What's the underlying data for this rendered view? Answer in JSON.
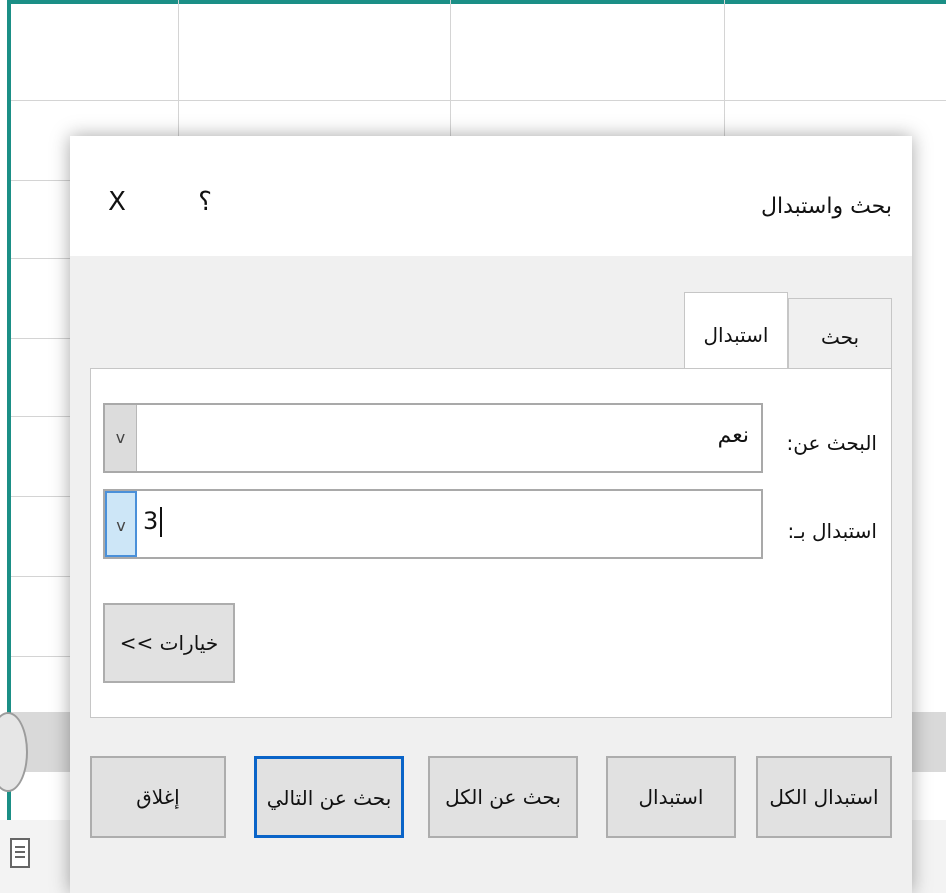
{
  "dialog": {
    "title": "بحث واستبدال",
    "help_label": "؟",
    "close_label": "X"
  },
  "tabs": [
    {
      "label": "بحث",
      "active": false
    },
    {
      "label": "استبدال",
      "active": true
    }
  ],
  "fields": {
    "find_label": "البحث عن:",
    "find_value": "نعم",
    "replace_label": "استبدال بـ:",
    "replace_value": "3"
  },
  "options_button": "خيارات >>",
  "buttons": {
    "replace_all": "استبدال الكل",
    "replace": "استبدال",
    "find_all": "بحث عن الكل",
    "find_next": "بحث عن التالي",
    "close": "إغلاق"
  },
  "dropdown_glyph": "v",
  "colors": {
    "accent_border": "#0a64c8",
    "sheet_border": "#1b8f86"
  }
}
